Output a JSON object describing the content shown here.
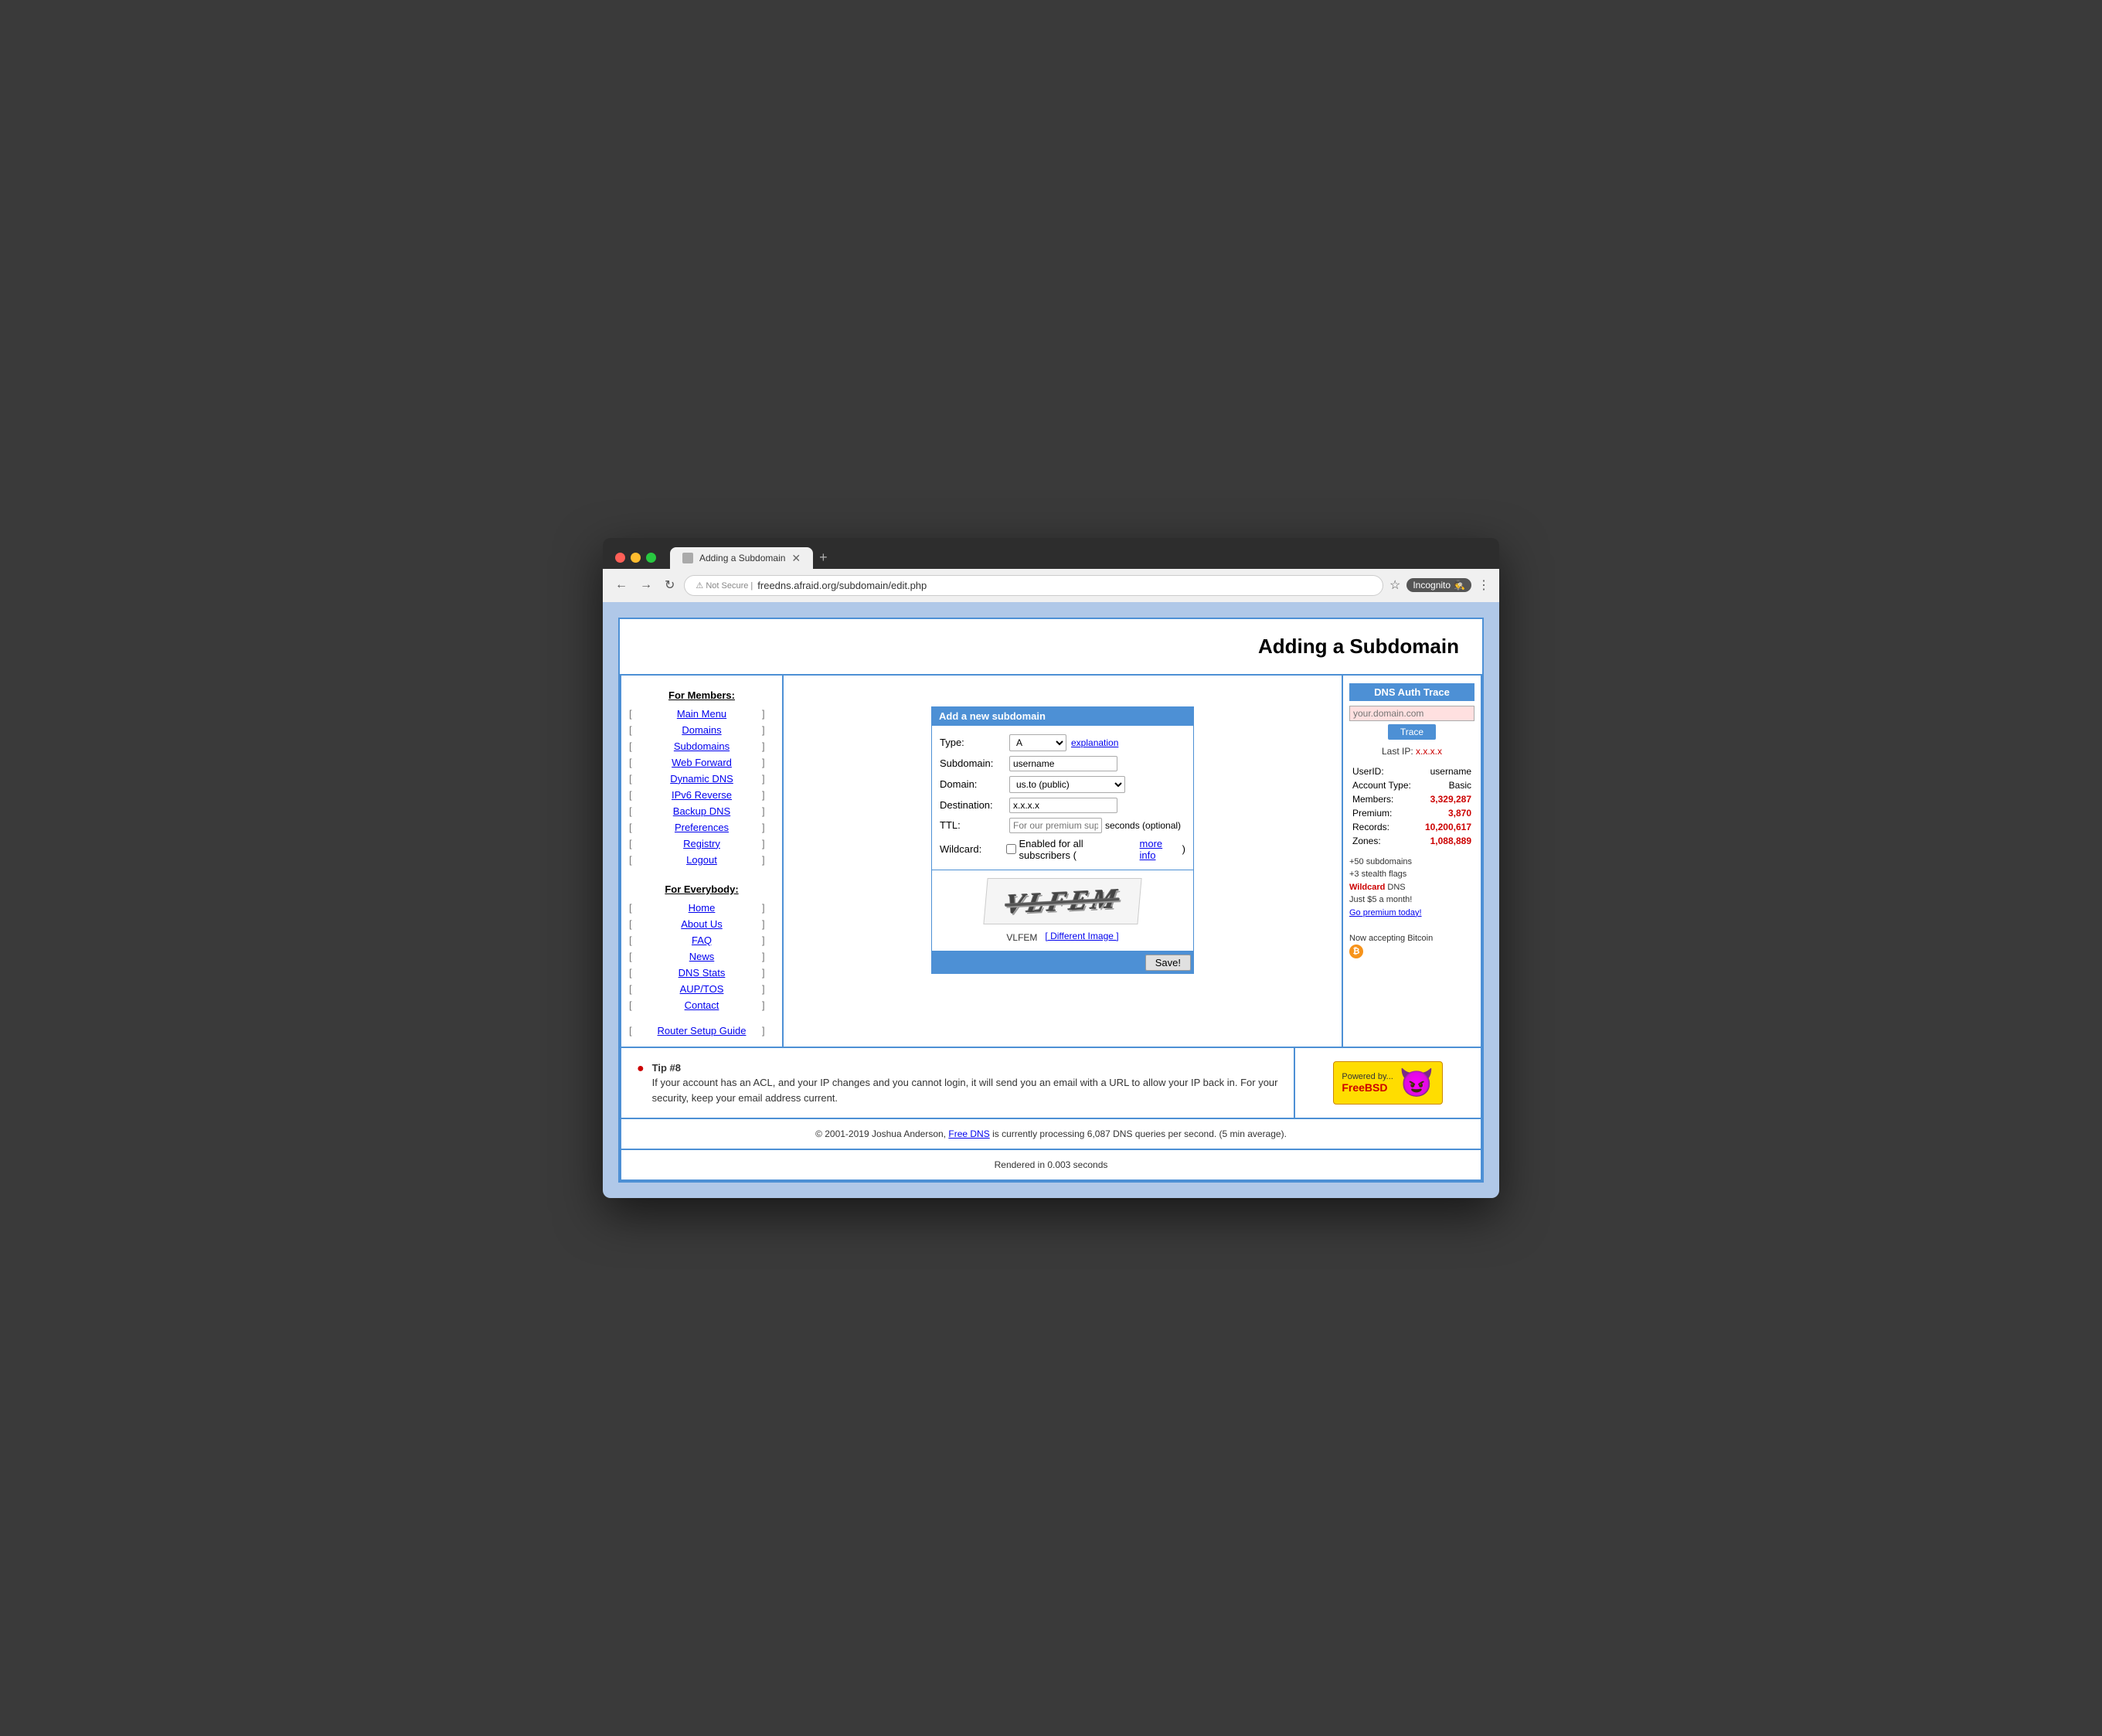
{
  "browser": {
    "tab_title": "Adding a Subdomain",
    "url_security": "Not Secure",
    "url_domain": "freedns.afraid.org/subdomain/edit.php",
    "incognito_label": "Incognito"
  },
  "page": {
    "title": "Adding a Subdomain"
  },
  "sidebar": {
    "members_title": "For Members:",
    "members_items": [
      {
        "label": "Main Menu",
        "href": "#"
      },
      {
        "label": "Domains",
        "href": "#"
      },
      {
        "label": "Subdomains",
        "href": "#"
      },
      {
        "label": "Web Forward",
        "href": "#"
      },
      {
        "label": "Dynamic DNS",
        "href": "#"
      },
      {
        "label": "IPv6 Reverse",
        "href": "#"
      },
      {
        "label": "Backup DNS",
        "href": "#"
      },
      {
        "label": "Preferences",
        "href": "#"
      },
      {
        "label": "Registry",
        "href": "#"
      },
      {
        "label": "Logout",
        "href": "#"
      }
    ],
    "everybody_title": "For Everybody:",
    "everybody_items": [
      {
        "label": "Home",
        "href": "#"
      },
      {
        "label": "About Us",
        "href": "#"
      },
      {
        "label": "FAQ",
        "href": "#"
      },
      {
        "label": "News",
        "href": "#"
      },
      {
        "label": "DNS Stats",
        "href": "#"
      },
      {
        "label": "AUP/TOS",
        "href": "#"
      },
      {
        "label": "Contact",
        "href": "#"
      }
    ],
    "router_item": "Router Setup Guide"
  },
  "form": {
    "header": "Add a new subdomain",
    "type_label": "Type:",
    "type_value": "A",
    "explanation_label": "explanation",
    "subdomain_label": "Subdomain:",
    "subdomain_value": "username",
    "domain_label": "Domain:",
    "domain_value": "us.to (public)",
    "destination_label": "Destination:",
    "destination_value": "x.x.x.x",
    "ttl_label": "TTL:",
    "ttl_placeholder": "For our premium suppor",
    "ttl_suffix": "seconds (optional)",
    "wildcard_label": "Wildcard:",
    "wildcard_text": "Enabled for all subscribers (",
    "more_info_label": "more info",
    "wildcard_close": ")",
    "captcha_text": "VLFEM",
    "different_image": "[ Different Image ]",
    "save_label": "Save!"
  },
  "right_panel": {
    "dns_auth_title": "DNS Auth Trace",
    "dns_placeholder": "your.domain.com",
    "trace_label": "Trace",
    "last_ip_label": "Last IP:",
    "last_ip_value": "x.x.x.x",
    "userid_label": "UserID:",
    "userid_value": "username",
    "account_type_label": "Account Type:",
    "account_type_value": "Basic",
    "members_label": "Members:",
    "members_value": "3,329,287",
    "premium_label": "Premium:",
    "premium_value": "3,870",
    "records_label": "Records:",
    "records_value": "10,200,617",
    "zones_label": "Zones:",
    "zones_value": "1,088,889",
    "promo_line1": "+50 subdomains",
    "promo_line2": "+3 stealth flags",
    "promo_wildcard": "Wildcard",
    "promo_dns": " DNS",
    "promo_price": "Just $5 a month!",
    "promo_link": "Go premium today!",
    "bitcoin_text": "Now accepting Bitcoin"
  },
  "tip": {
    "title": "Tip #8",
    "text": "If your account has an ACL, and your IP changes and you cannot login, it will send you an email with a URL to allow your IP back in. For your security, keep your email address current.",
    "powered_by": "Powered by...",
    "freebsd_label": "FreeBSD"
  },
  "footer": {
    "copyright": "© 2001-2019 Joshua Anderson,",
    "free_dns_link": "Free DNS",
    "footer_text": " is currently processing 6,087 DNS queries per second. (5 min average).",
    "rendered": "Rendered in 0.003 seconds"
  }
}
